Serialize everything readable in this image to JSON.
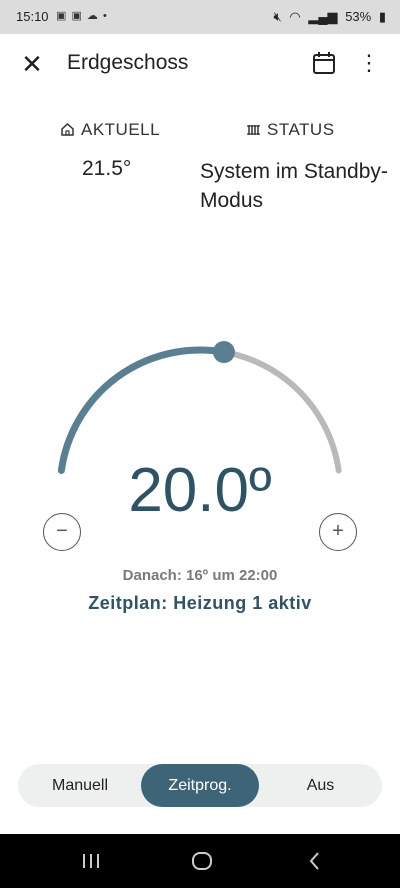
{
  "status_bar": {
    "time": "15:10",
    "notification_icons": [
      "teams-icon",
      "teams-icon",
      "cloud-icon",
      "dot-icon"
    ],
    "battery": "53%"
  },
  "header": {
    "title": "Erdgeschoss",
    "close_icon": "close-icon",
    "calendar_icon": "calendar-icon",
    "more_icon": "more-vert-icon"
  },
  "info": {
    "current_label": "AKTUELL",
    "current_value": "21.5°",
    "status_label": "STATUS",
    "status_value": "System im Standby-Modus"
  },
  "thermostat": {
    "setpoint": "20.0º",
    "arc_fill_fraction": 0.56,
    "colors": {
      "active": "#5a7f92",
      "inactive": "#b9b9b9"
    },
    "minus_label": "−",
    "plus_label": "+"
  },
  "schedule": {
    "next_text": "Danach: 16º um 22:00",
    "active_text": "Zeitplan: Heizung 1 aktiv"
  },
  "modes": {
    "items": [
      {
        "label": "Manuell"
      },
      {
        "label": "Zeitprog."
      },
      {
        "label": "Aus"
      }
    ],
    "selected": "Zeitprog."
  }
}
